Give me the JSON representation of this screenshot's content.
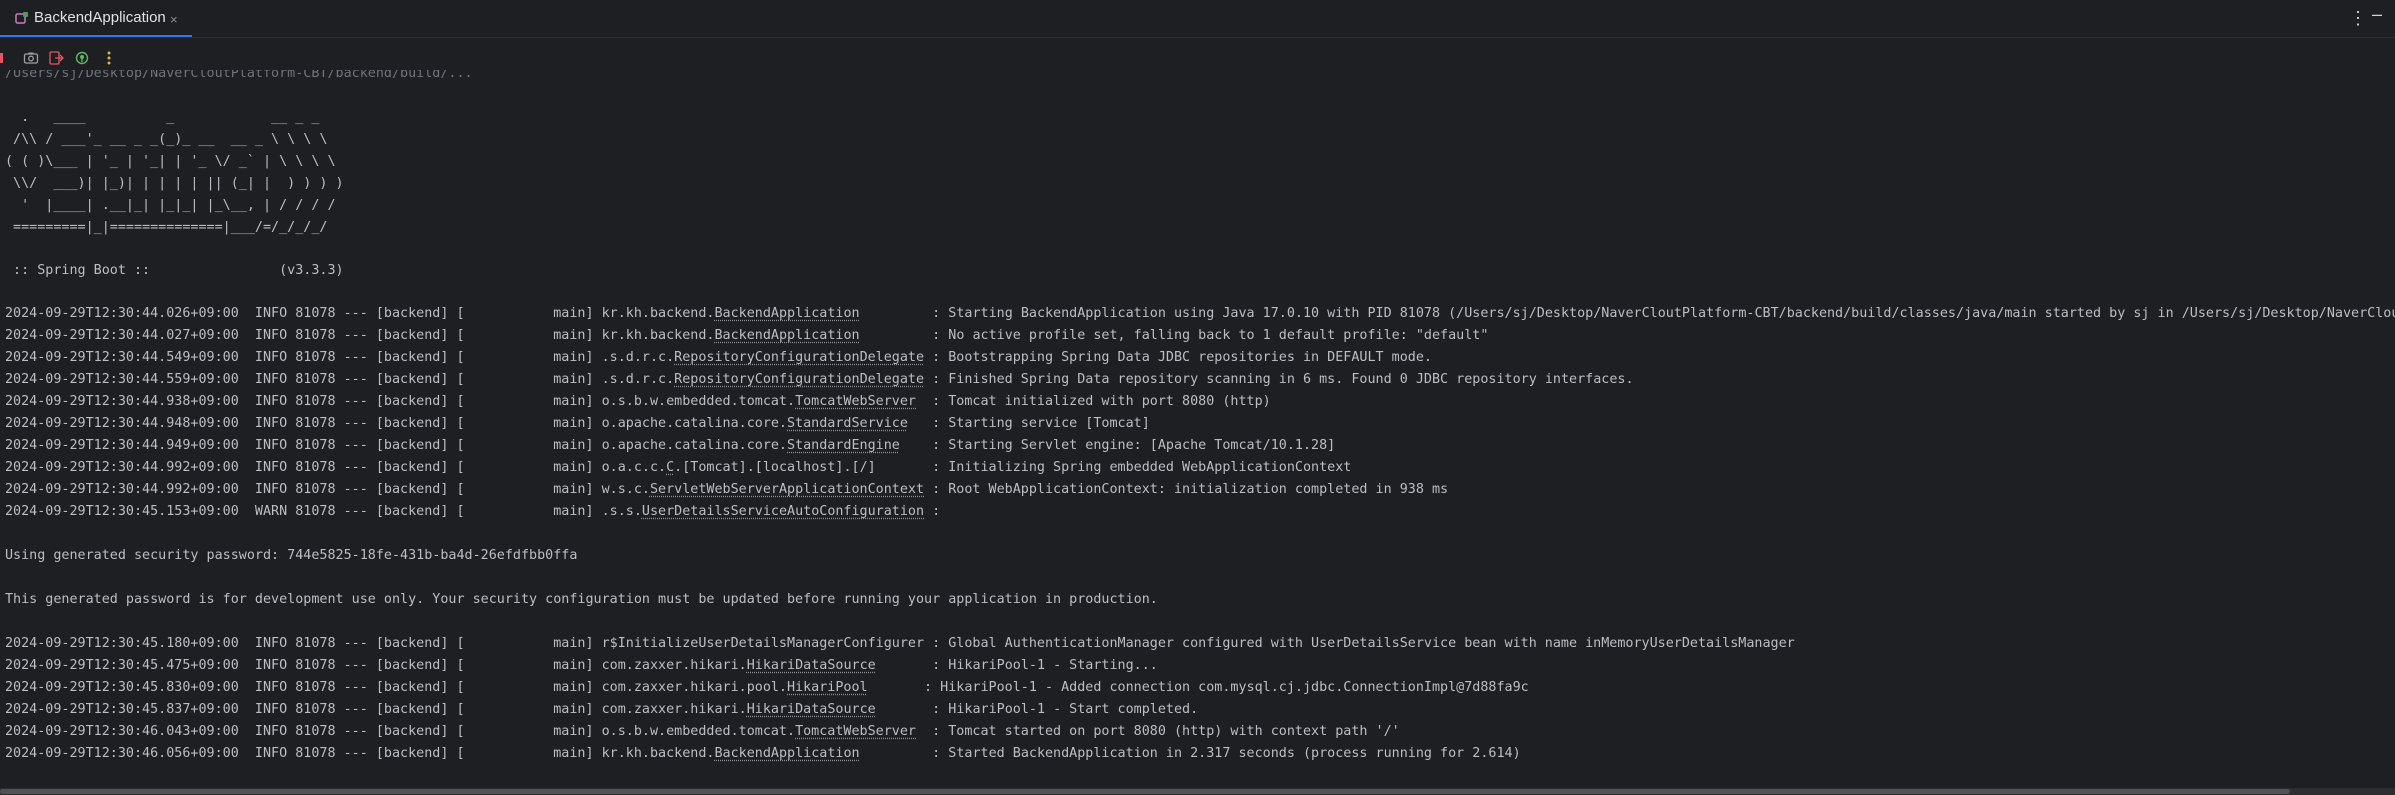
{
  "tab": {
    "title": "BackendApplication",
    "close": "×"
  },
  "toolbar": {
    "icons": [
      "camera-icon",
      "exit-icon",
      "bug-icon",
      "more-vertical-icon"
    ]
  },
  "console": {
    "top_cut_line": "/Users/sj/Desktop/NaverCloutPlatform-CBT/backend/build/...",
    "banner": [
      "  .   ____          _            __ _ _",
      " /\\\\ / ___'_ __ _ _(_)_ __  __ _ \\ \\ \\ \\",
      "( ( )\\___ | '_ | '_| | '_ \\/ _` | \\ \\ \\ \\",
      " \\\\/  ___)| |_)| | | | | || (_| |  ) ) ) )",
      "  '  |____| .__|_| |_|_| |_\\__, | / / / /",
      " =========|_|==============|___/=/_/_/_/"
    ],
    "spring_boot": " :: Spring Boot ::                (v3.3.3)",
    "logs1": [
      {
        "pre": "2024-09-29T12:30:44.026+09:00  INFO 81078 --- [backend] [           main] kr.kh.backend.",
        "ul": "BackendApplication",
        "post": "         : Starting BackendApplication using Java 17.0.10 with PID 81078 (/Users/sj/Desktop/NaverCloutPlatform-CBT/backend/build/classes/java/main started by sj in /Users/sj/Desktop/NaverCloutPlatform"
      },
      {
        "pre": "2024-09-29T12:30:44.027+09:00  INFO 81078 --- [backend] [           main] kr.kh.backend.",
        "ul": "BackendApplication",
        "post": "         : No active profile set, falling back to 1 default profile: \"default\""
      },
      {
        "pre": "2024-09-29T12:30:44.549+09:00  INFO 81078 --- [backend] [           main] .s.d.r.c.",
        "ul": "RepositoryConfigurationDelegate",
        "post": " : Bootstrapping Spring Data JDBC repositories in DEFAULT mode."
      },
      {
        "pre": "2024-09-29T12:30:44.559+09:00  INFO 81078 --- [backend] [           main] .s.d.r.c.",
        "ul": "RepositoryConfigurationDelegate",
        "post": " : Finished Spring Data repository scanning in 6 ms. Found 0 JDBC repository interfaces."
      },
      {
        "pre": "2024-09-29T12:30:44.938+09:00  INFO 81078 --- [backend] [           main] o.s.b.w.embedded.tomcat.",
        "ul": "TomcatWebServer",
        "post": "  : Tomcat initialized with port 8080 (http)"
      },
      {
        "pre": "2024-09-29T12:30:44.948+09:00  INFO 81078 --- [backend] [           main] o.apache.catalina.core.",
        "ul": "StandardService",
        "post": "   : Starting service [Tomcat]"
      },
      {
        "pre": "2024-09-29T12:30:44.949+09:00  INFO 81078 --- [backend] [           main] o.apache.catalina.core.",
        "ul": "StandardEngine",
        "post": "    : Starting Servlet engine: [Apache Tomcat/10.1.28]"
      },
      {
        "pre": "2024-09-29T12:30:44.992+09:00  INFO 81078 --- [backend] [           main] o.a.c.c.",
        "ul": "C",
        "post": ".[Tomcat].[localhost].[/]       : Initializing Spring embedded WebApplicationContext"
      },
      {
        "pre": "2024-09-29T12:30:44.992+09:00  INFO 81078 --- [backend] [           main] w.s.c.",
        "ul": "ServletWebServerApplicationContext",
        "post": " : Root WebApplicationContext: initialization completed in 938 ms"
      },
      {
        "pre": "2024-09-29T12:30:45.153+09:00  WARN 81078 --- [backend] [           main] .s.s.",
        "ul": "UserDetailsServiceAutoConfiguration",
        "post": " :"
      }
    ],
    "password_line": "Using generated security password: 744e5825-18fe-431b-ba4d-26efdfbb0ffa",
    "dev_note": "This generated password is for development use only. Your security configuration must be updated before running your application in production.",
    "logs2": [
      {
        "pre": "2024-09-29T12:30:45.180+09:00  INFO 81078 --- [backend] [           main] r$InitializeUserDetailsManagerConfigurer : Global AuthenticationManager configured with UserDetailsService bean with name inMemoryUserDetailsManager",
        "ul": "",
        "post": ""
      },
      {
        "pre": "2024-09-29T12:30:45.475+09:00  INFO 81078 --- [backend] [           main] com.zaxxer.hikari.",
        "ul": "HikariDataSource",
        "post": "       : HikariPool-1 - Starting..."
      },
      {
        "pre": "2024-09-29T12:30:45.830+09:00  INFO 81078 --- [backend] [           main] com.zaxxer.hikari.pool.",
        "ul": "HikariPool",
        "post": "       : HikariPool-1 - Added connection com.mysql.cj.jdbc.ConnectionImpl@7d88fa9c"
      },
      {
        "pre": "2024-09-29T12:30:45.837+09:00  INFO 81078 --- [backend] [           main] com.zaxxer.hikari.",
        "ul": "HikariDataSource",
        "post": "       : HikariPool-1 - Start completed."
      },
      {
        "pre": "2024-09-29T12:30:46.043+09:00  INFO 81078 --- [backend] [           main] o.s.b.w.embedded.tomcat.",
        "ul": "TomcatWebServer",
        "post": "  : Tomcat started on port 8080 (http) with context path '/'"
      },
      {
        "pre": "2024-09-29T12:30:46.056+09:00  INFO 81078 --- [backend] [           main] kr.kh.backend.",
        "ul": "BackendApplication",
        "post": "         : Started BackendApplication in 2.317 seconds (process running for 2.614)"
      }
    ]
  }
}
